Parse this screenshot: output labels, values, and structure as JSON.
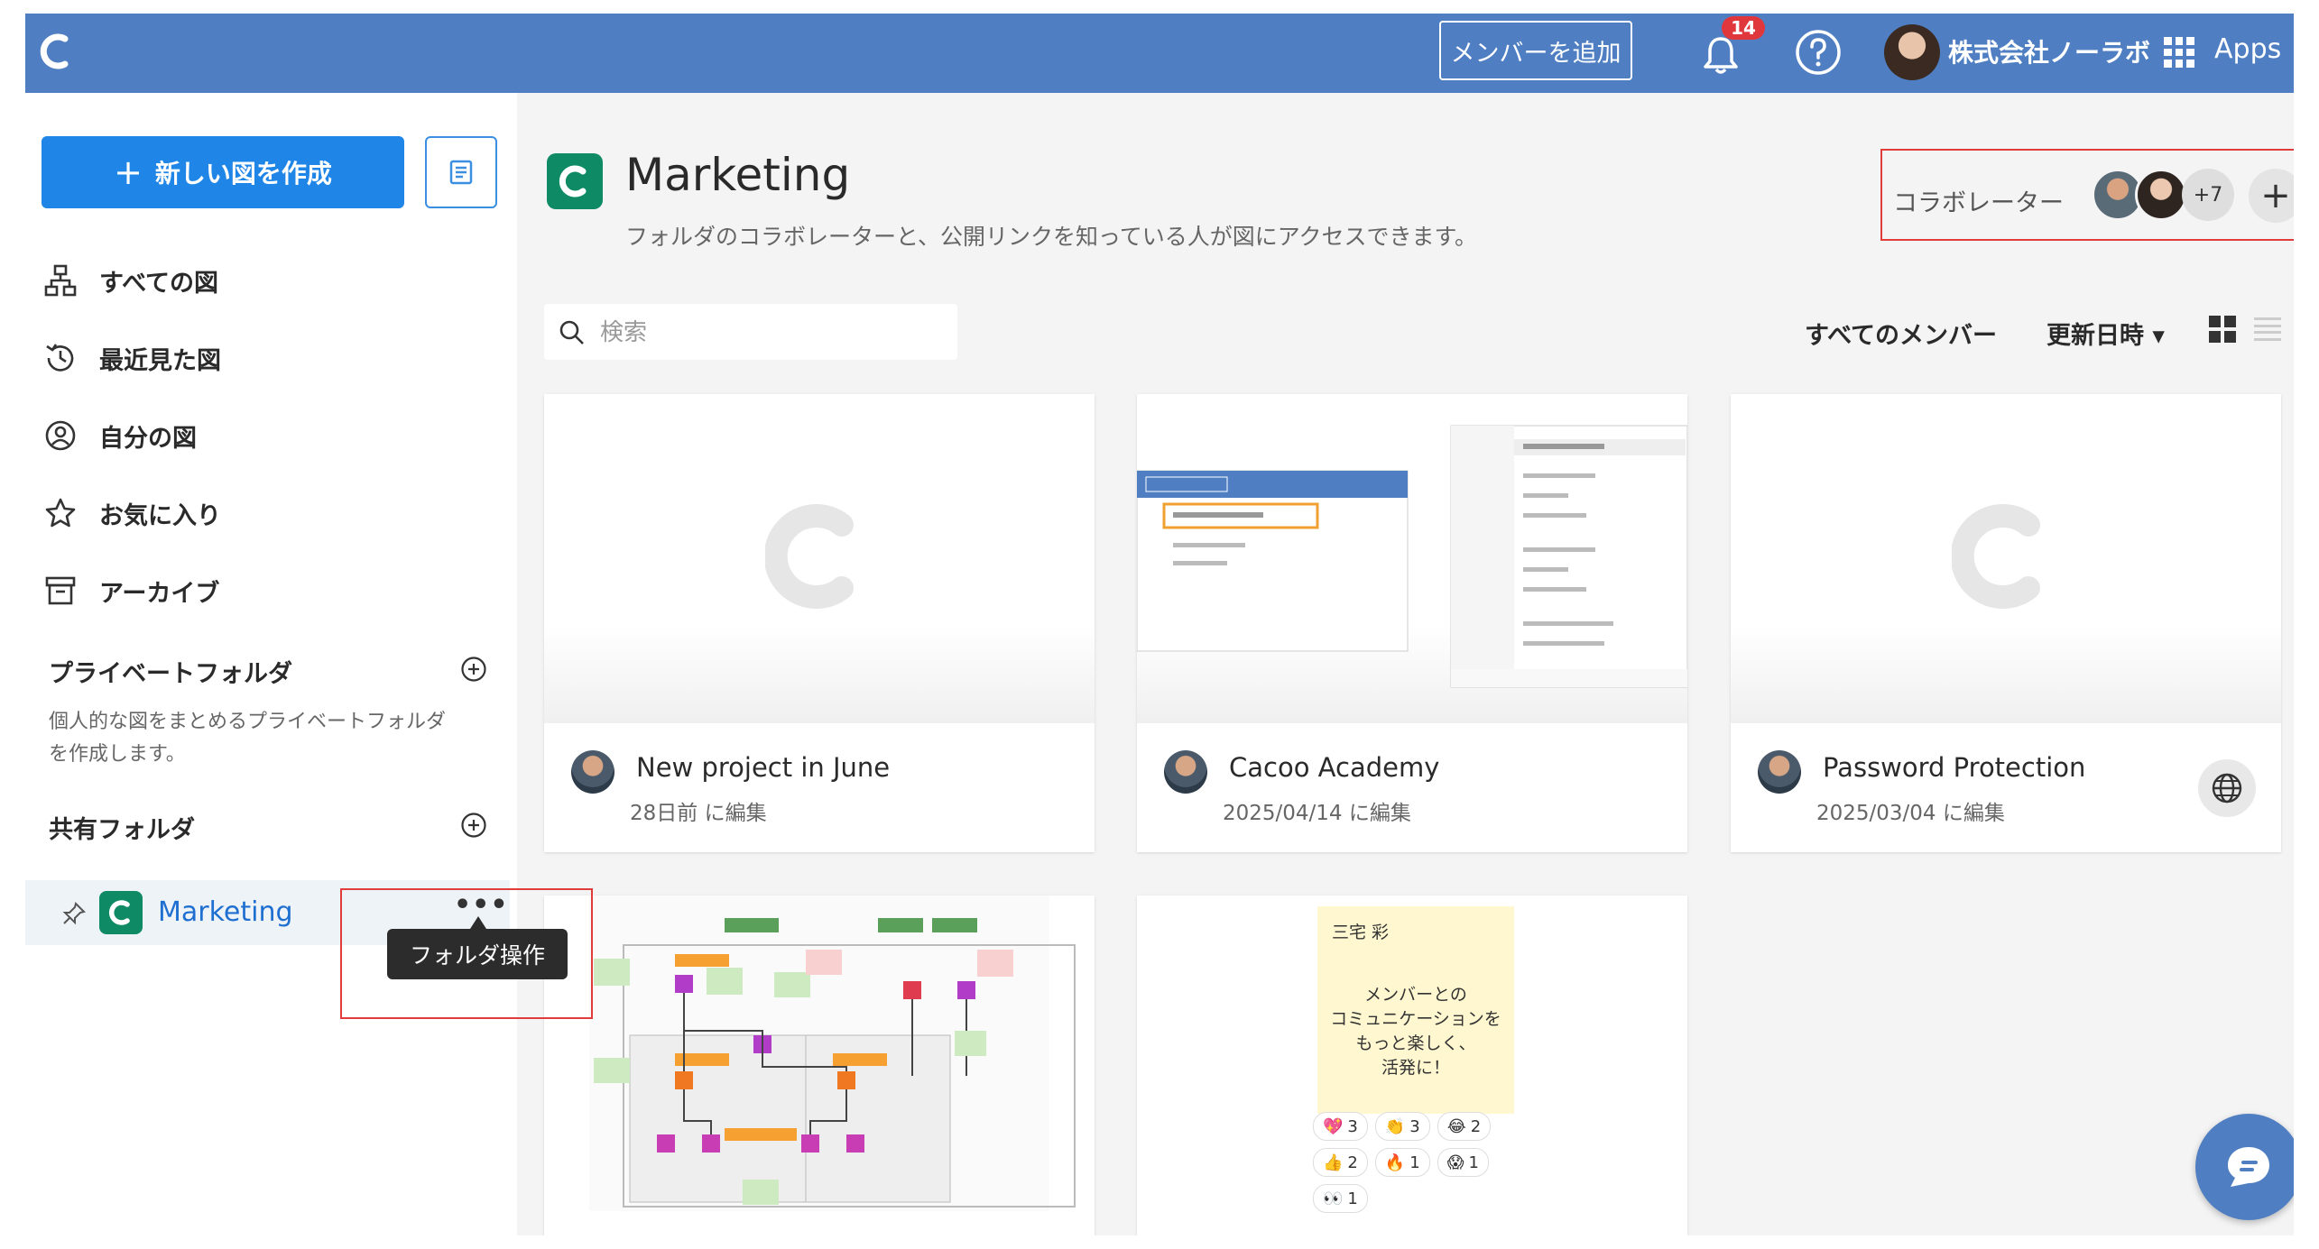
{
  "topbar": {
    "add_member": "メンバーを追加",
    "notification_count": "14",
    "org_name": "株式会社ノーラボ",
    "apps": "Apps"
  },
  "sidebar": {
    "new_diagram": "新しい図を作成",
    "nav": [
      {
        "label": "すべての図",
        "icon": "diagram-tree-icon"
      },
      {
        "label": "最近見た図",
        "icon": "history-icon"
      },
      {
        "label": "自分の図",
        "icon": "user-circle-icon"
      },
      {
        "label": "お気に入り",
        "icon": "star-icon"
      },
      {
        "label": "アーカイブ",
        "icon": "archive-icon"
      }
    ],
    "private_folder": {
      "title": "プライベートフォルダ",
      "description": "個人的な図をまとめるプライベートフォルダを作成します。"
    },
    "shared_folder": {
      "title": "共有フォルダ",
      "folder_name": "Marketing",
      "menu": "•••",
      "tooltip": "フォルダ操作"
    }
  },
  "main": {
    "title": "Marketing",
    "subtitle": "フォルダのコラボレーターと、公開リンクを知っている人が図にアクセスできます。",
    "collaborators": {
      "label": "コラボレーター",
      "more": "+7",
      "add": "+"
    },
    "search_placeholder": "検索",
    "filter_members": "すべてのメンバー",
    "sort": "更新日時 ▾",
    "cards": [
      {
        "title": "New project in June",
        "date": "28日前 に編集"
      },
      {
        "title": "Cacoo Academy",
        "date": "2025/04/14 に編集"
      },
      {
        "title": "Password Protection",
        "date": "2025/03/04 に編集",
        "public": true
      }
    ],
    "sticky": {
      "author": "三宅 彩",
      "text": "メンバーとの\nコミュニケーションを\nもっと楽しく、\n活発に！",
      "reactions": [
        {
          "emoji": "💖",
          "count": "3"
        },
        {
          "emoji": "👏",
          "count": "3"
        },
        {
          "emoji": "😂",
          "count": "2"
        },
        {
          "emoji": "👍",
          "count": "2"
        },
        {
          "emoji": "🔥",
          "count": "1"
        },
        {
          "emoji": "😱",
          "count": "1"
        },
        {
          "emoji": "👀",
          "count": "1"
        }
      ]
    }
  },
  "colors": {
    "topbar": "#4f7fc2",
    "primary_button": "#1f86e8",
    "folder_green": "#0e8a65",
    "highlight_red": "#e03c3c"
  }
}
